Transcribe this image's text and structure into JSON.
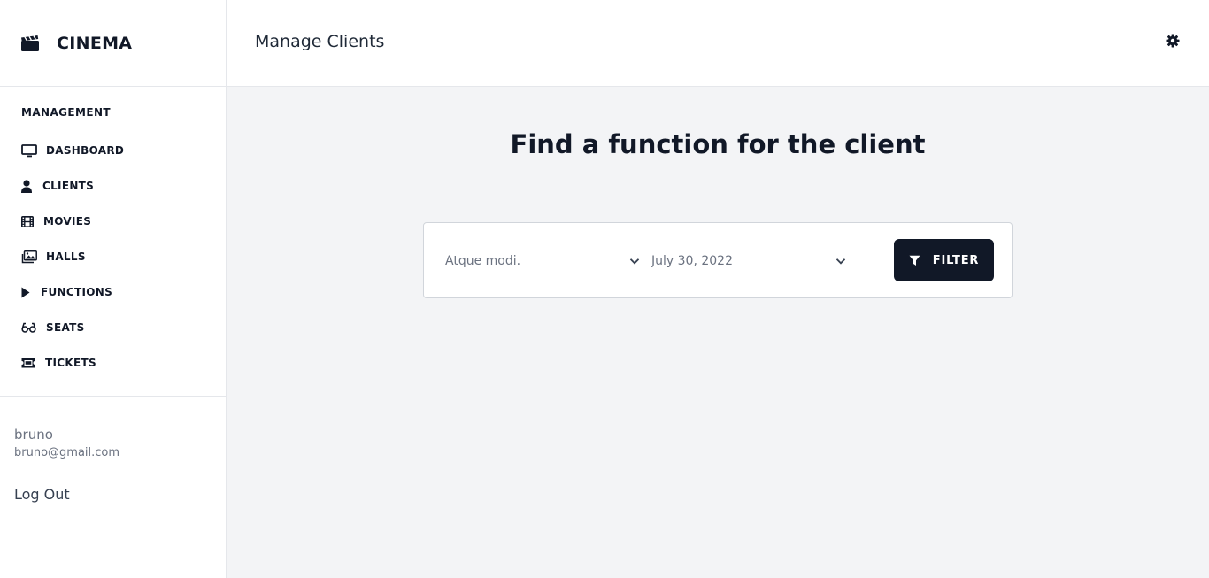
{
  "brand": {
    "name": "CINEMA",
    "icon": "clapperboard-icon"
  },
  "sidebar": {
    "section_title": "MANAGEMENT",
    "items": [
      {
        "label": "DASHBOARD",
        "icon": "monitor-icon"
      },
      {
        "label": "CLIENTS",
        "icon": "user-icon"
      },
      {
        "label": "MOVIES",
        "icon": "film-icon"
      },
      {
        "label": "HALLS",
        "icon": "images-icon"
      },
      {
        "label": "FUNCTIONS",
        "icon": "play-icon"
      },
      {
        "label": "SEATS",
        "icon": "glasses-icon"
      },
      {
        "label": "TICKETS",
        "icon": "ticket-icon"
      }
    ]
  },
  "user": {
    "name": "bruno",
    "email": "bruno@gmail.com",
    "logout_label": "Log Out"
  },
  "header": {
    "title": "Manage Clients",
    "settings_icon": "gear-icon"
  },
  "main": {
    "heading": "Find a function for the client",
    "filter": {
      "client_select_value": "Atque modi.",
      "date_select_value": "July 30, 2022",
      "button_label": "FILTER",
      "button_icon": "filter-icon"
    }
  },
  "colors": {
    "background": "#f3f4f6",
    "surface": "#ffffff",
    "primary_button": "#111827",
    "text_muted": "#6b7280"
  }
}
